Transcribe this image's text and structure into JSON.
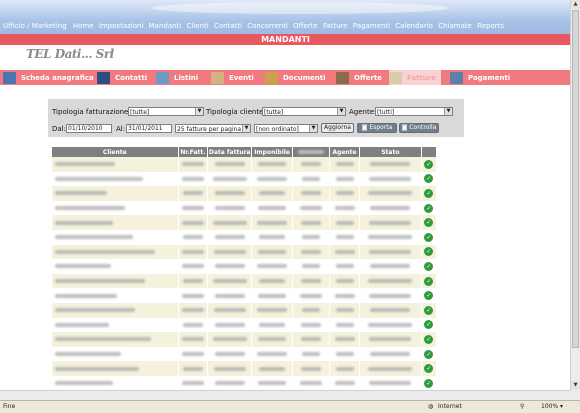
{
  "topnav": {
    "brand": "Ufficio / Marketing",
    "links": [
      "Home",
      "Impostazioni",
      "Mandanti",
      "Clienti",
      "Contatti",
      "Concorrenti",
      "Offerte",
      "Fatture",
      "Pagamenti",
      "Calendario",
      "Chiamate",
      "Reports"
    ]
  },
  "page_title": "MANDANTI",
  "logo_text": "TEL Dati... Srl",
  "tabs": [
    {
      "label": "Scheda anagrafica",
      "icon": "building-icon",
      "color": "#4a76b0"
    },
    {
      "label": "Contatti",
      "icon": "contacts-icon",
      "color": "#2b4d7f"
    },
    {
      "label": "Listini",
      "icon": "list-icon",
      "color": "#6d9ac7"
    },
    {
      "label": "Eventi",
      "icon": "calendar-icon",
      "color": "#d3b480"
    },
    {
      "label": "Documenti",
      "icon": "document-icon",
      "color": "#c9a24c"
    },
    {
      "label": "Offerte",
      "icon": "offer-icon",
      "color": "#8a6b4b"
    },
    {
      "label": "Fatture",
      "icon": "invoice-icon",
      "color": "#d8cda7"
    },
    {
      "label": "Pagamenti",
      "icon": "payment-icon",
      "color": "#5e7faa"
    }
  ],
  "filters": {
    "tipologia_fatturazione_label": "Tipologia fatturazione:",
    "tipologia_fatturazione_value": "[tutte]",
    "tipologia_cliente_label": "Tipologia cliente:",
    "tipologia_cliente_value": "[tutte]",
    "agente_label": "Agente:",
    "agente_value": "[tutti]",
    "dal_label": "Dal:",
    "dal_value": "01/10/2010",
    "al_label": "Al:",
    "al_value": "31/01/2011",
    "per_page_value": "25 fatture per pagina",
    "order_value": "[non ordinato]",
    "aggiorna_label": "Aggiorna",
    "esporta_label": "Esporta",
    "controlla_label": "Controlla"
  },
  "table": {
    "headers": [
      "Cliente",
      "Nr.Fatt.",
      "Data fattura",
      "Imponibile",
      "",
      "Agente",
      "Stato"
    ],
    "rows": 16,
    "row_colors": [
      "#f4f1dc",
      "#ffffff"
    ]
  },
  "statusbar": {
    "left": "Fine",
    "zone": "Internet",
    "zoom": "100%"
  }
}
